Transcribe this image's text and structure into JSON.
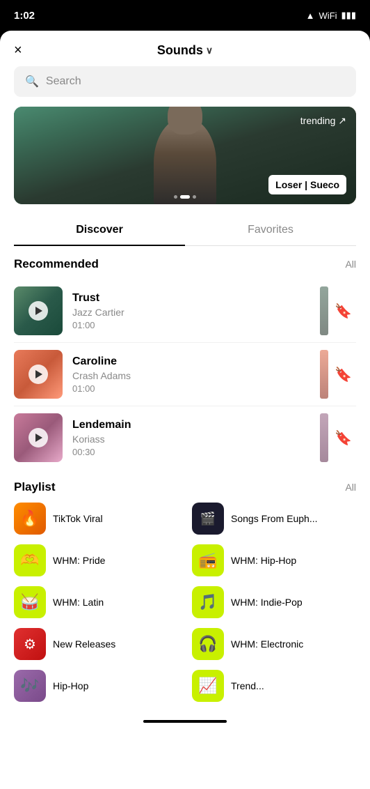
{
  "status": {
    "time": "1:02",
    "battery": "▮▮▮",
    "signal": "●●●"
  },
  "header": {
    "close_label": "×",
    "title": "Sounds",
    "chevron": "∨"
  },
  "search": {
    "placeholder": "Search"
  },
  "banner": {
    "trending_label": "trending ↗",
    "song_label": "Loser | Sueco"
  },
  "tabs": [
    {
      "id": "discover",
      "label": "Discover",
      "active": true
    },
    {
      "id": "favorites",
      "label": "Favorites",
      "active": false
    }
  ],
  "recommended": {
    "section_title": "Recommended",
    "all_label": "All",
    "tracks": [
      {
        "id": "trust",
        "name": "Trust",
        "artist": "Jazz Cartier",
        "duration": "01:00",
        "color": "trust"
      },
      {
        "id": "caroline",
        "name": "Caroline",
        "artist": "Crash Adams",
        "duration": "01:00",
        "color": "caroline"
      },
      {
        "id": "lendemain",
        "name": "Lendemain",
        "artist": "Koriass",
        "duration": "00:30",
        "color": "lendemain"
      }
    ]
  },
  "playlist": {
    "section_title": "Playlist",
    "all_label": "All",
    "items": [
      {
        "id": "tiktok-viral",
        "name": "TikTok Viral",
        "icon": "🔥",
        "bg": "bg-orange"
      },
      {
        "id": "songs-from-euph",
        "name": "Songs From Euph...",
        "icon": "🎬",
        "bg": "bg-dark-img"
      },
      {
        "id": "whm-pride",
        "name": "WHM: Pride",
        "icon": "🫶",
        "bg": "bg-lime"
      },
      {
        "id": "whm-hiphop",
        "name": "WHM: Hip-Hop",
        "icon": "📻",
        "bg": "bg-lime2"
      },
      {
        "id": "whm-latin",
        "name": "WHM: Latin",
        "icon": "🥁",
        "bg": "bg-lime3"
      },
      {
        "id": "whm-indie-pop",
        "name": "WHM: Indie-Pop",
        "icon": "🎵",
        "bg": "bg-lime4"
      },
      {
        "id": "new-releases",
        "name": "New Releases",
        "icon": "⚙",
        "bg": "bg-red"
      },
      {
        "id": "whm-electronic",
        "name": "WHM: Electronic",
        "icon": "🎧",
        "bg": "bg-lime5"
      }
    ]
  }
}
